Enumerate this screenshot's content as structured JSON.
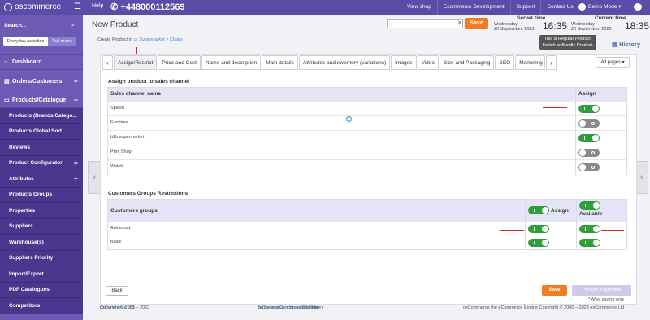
{
  "topbar": {
    "logo": "oscommerce",
    "help": "Help",
    "phone": "+448000112569",
    "nav": [
      "View shop",
      "Ecommerce Development",
      "Support",
      "Contact Us"
    ],
    "user": "Demo Mode"
  },
  "sidebar": {
    "search_label": "Search...",
    "seg_everyday": "Everyday activities",
    "seg_full": "Full menu",
    "items": [
      {
        "label": "Dashboard",
        "icon": "dashboard-icon"
      },
      {
        "label": "Orders/Customers",
        "icon": "orders-icon",
        "toggle": "+"
      },
      {
        "label": "Products/Catalogue",
        "icon": "catalogue-icon",
        "toggle": "−"
      }
    ],
    "subitems": [
      {
        "label": "Products (Brands/Catego..."
      },
      {
        "label": "Products Global Sort"
      },
      {
        "label": "Reviews"
      },
      {
        "label": "Product Configurator",
        "toggle": "+"
      },
      {
        "label": "Attributes",
        "toggle": "+"
      },
      {
        "label": "Products Groups"
      },
      {
        "label": "Properties"
      },
      {
        "label": "Suppliers"
      },
      {
        "label": "Warehouse(s)"
      },
      {
        "label": "Suppliers Priority"
      },
      {
        "label": "Import/Export"
      },
      {
        "label": "PDF Catalogues"
      },
      {
        "label": "Competitors"
      }
    ]
  },
  "header": {
    "title": "New Product",
    "save": "Save",
    "server_time_label": "Server time",
    "current_time_label": "Current time",
    "server_day": "Wednesday",
    "server_date": "20 September, 2023",
    "server_time": "16:35",
    "current_day": "Wednesday",
    "current_date": "20 September, 2023",
    "current_time": "18:35",
    "breadcrumb_prefix": "Create Product in",
    "breadcrumb_path": "Supermarket > Chairs",
    "tooltip_line1": "This is Regular Product.",
    "tooltip_line2": "Switch to Bundle Product.",
    "history": "History"
  },
  "tabs": [
    "Assign/Restrict",
    "Price and Cost",
    "Name and description",
    "Main details",
    "Attributes and inventory (variations)",
    "Images",
    "Video",
    "Size and Packaging",
    "SEO",
    "Marketing"
  ],
  "all_pages": "All pages",
  "sales_channel": {
    "title": "Assign product to sales channel",
    "col_name": "Sales channel name",
    "col_assign": "Assign",
    "rows": [
      {
        "name": "Splesh",
        "on": true
      },
      {
        "name": "Furniture",
        "on": false
      },
      {
        "name": "b2b supermarket",
        "on": true
      },
      {
        "name": "Print Shop",
        "on": false
      },
      {
        "name": "Watch",
        "on": false
      }
    ]
  },
  "customer_groups": {
    "title": "Customers Groups Restrictions",
    "col_name": "Customers groups",
    "col_assign": "Assign",
    "col_available": "Available",
    "rows": [
      {
        "name": "Advanced",
        "assign": true,
        "available": true
      },
      {
        "name": "Basic",
        "assign": true,
        "available": true
      }
    ]
  },
  "actions": {
    "back": "Back",
    "save": "Save",
    "preview": "Preview in light box",
    "after_saving": "* After saving only"
  },
  "footer": {
    "copyright": "Copyright © 2005 – 2023",
    "copyright_link": "osCommerce Ltd",
    "middle_prefix": "osCommerce is provided under",
    "terms": "Terms and Conditions",
    "and": "and this",
    "disclaimer": "Disclaimer",
    "right": "osCommerce the eCommerce Engine Copyright © 2000 – 2023 osCommerce Ltd"
  },
  "colors": {
    "primary": "#5b4ca8",
    "sidebar": "#6d5ab5",
    "accent": "#f47c20",
    "toggle_on": "#2d9e3a"
  }
}
